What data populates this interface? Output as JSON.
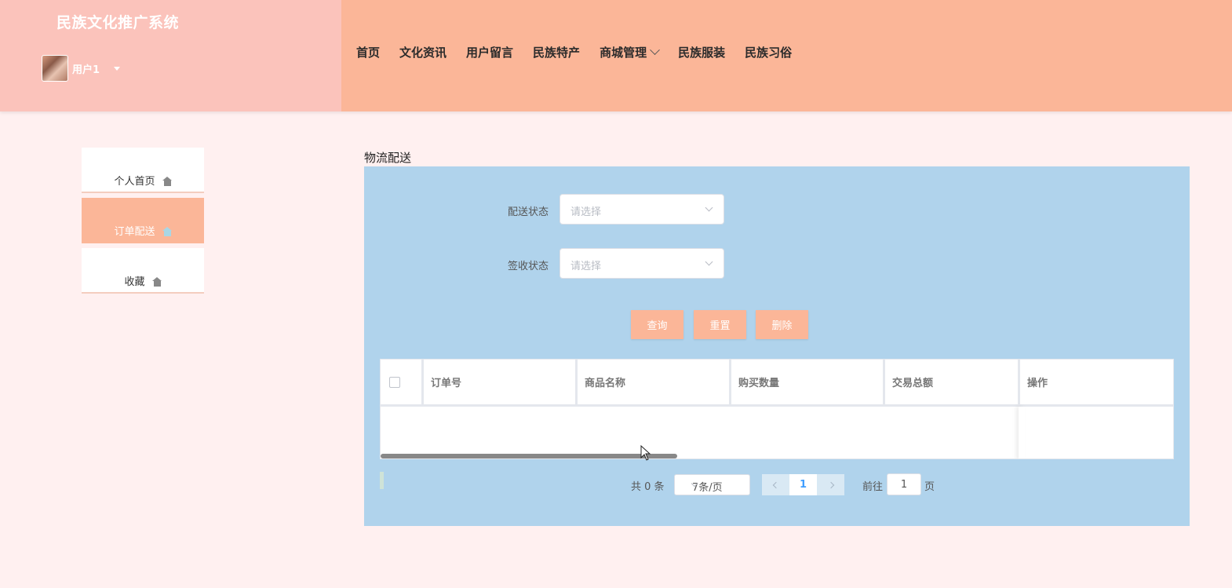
{
  "header": {
    "site_title": "民族文化推广系统",
    "user_name": "用户1",
    "nav": [
      {
        "label": "首页"
      },
      {
        "label": "文化资讯"
      },
      {
        "label": "用户留言"
      },
      {
        "label": "民族特产"
      },
      {
        "label": "商城管理"
      },
      {
        "label": "民族服装"
      },
      {
        "label": "民族习俗"
      }
    ]
  },
  "sidebar": {
    "items": [
      {
        "label": "个人首页",
        "icon": "home-icon"
      },
      {
        "label": "订单配送",
        "icon": "home-icon",
        "active": true
      },
      {
        "label": "收藏",
        "icon": "home-icon"
      }
    ]
  },
  "main": {
    "title": "物流配送",
    "filters": [
      {
        "label": "配送状态",
        "placeholder": "请选择"
      },
      {
        "label": "签收状态",
        "placeholder": "请选择"
      }
    ],
    "buttons": {
      "query": "查询",
      "reset": "重置",
      "delete": "删除"
    },
    "table": {
      "columns": [
        "订单号",
        "商品名称",
        "购买数量",
        "交易总额",
        "操作"
      ],
      "rows": []
    },
    "pagination": {
      "total_text": "共 0 条",
      "page_size": "7条/页",
      "current_page": "1",
      "goto_label": "前往",
      "goto_value": "1",
      "page_suffix": "页"
    }
  },
  "colors": {
    "header_bg": "#fbb698",
    "brand_panel_bg": "#fbc3bb",
    "page_bg": "#fff0f0",
    "panel_bg": "#b0d3ec",
    "button_bg": "#fbb698"
  }
}
